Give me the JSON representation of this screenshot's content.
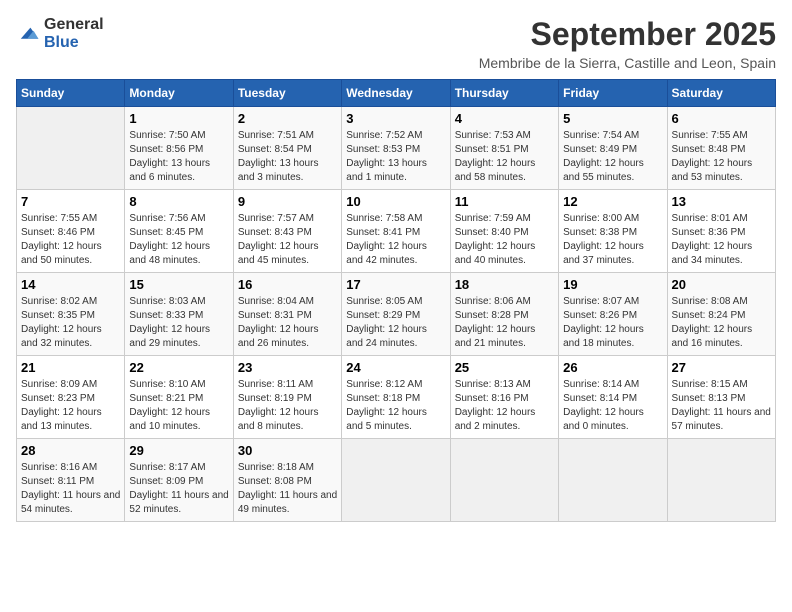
{
  "header": {
    "logo_line1": "General",
    "logo_line2": "Blue",
    "month_title": "September 2025",
    "subtitle": "Membribe de la Sierra, Castille and Leon, Spain"
  },
  "weekdays": [
    "Sunday",
    "Monday",
    "Tuesday",
    "Wednesday",
    "Thursday",
    "Friday",
    "Saturday"
  ],
  "weeks": [
    [
      {
        "day": "",
        "sunrise": "",
        "sunset": "",
        "daylight": ""
      },
      {
        "day": "1",
        "sunrise": "Sunrise: 7:50 AM",
        "sunset": "Sunset: 8:56 PM",
        "daylight": "Daylight: 13 hours and 6 minutes."
      },
      {
        "day": "2",
        "sunrise": "Sunrise: 7:51 AM",
        "sunset": "Sunset: 8:54 PM",
        "daylight": "Daylight: 13 hours and 3 minutes."
      },
      {
        "day": "3",
        "sunrise": "Sunrise: 7:52 AM",
        "sunset": "Sunset: 8:53 PM",
        "daylight": "Daylight: 13 hours and 1 minute."
      },
      {
        "day": "4",
        "sunrise": "Sunrise: 7:53 AM",
        "sunset": "Sunset: 8:51 PM",
        "daylight": "Daylight: 12 hours and 58 minutes."
      },
      {
        "day": "5",
        "sunrise": "Sunrise: 7:54 AM",
        "sunset": "Sunset: 8:49 PM",
        "daylight": "Daylight: 12 hours and 55 minutes."
      },
      {
        "day": "6",
        "sunrise": "Sunrise: 7:55 AM",
        "sunset": "Sunset: 8:48 PM",
        "daylight": "Daylight: 12 hours and 53 minutes."
      }
    ],
    [
      {
        "day": "7",
        "sunrise": "Sunrise: 7:55 AM",
        "sunset": "Sunset: 8:46 PM",
        "daylight": "Daylight: 12 hours and 50 minutes."
      },
      {
        "day": "8",
        "sunrise": "Sunrise: 7:56 AM",
        "sunset": "Sunset: 8:45 PM",
        "daylight": "Daylight: 12 hours and 48 minutes."
      },
      {
        "day": "9",
        "sunrise": "Sunrise: 7:57 AM",
        "sunset": "Sunset: 8:43 PM",
        "daylight": "Daylight: 12 hours and 45 minutes."
      },
      {
        "day": "10",
        "sunrise": "Sunrise: 7:58 AM",
        "sunset": "Sunset: 8:41 PM",
        "daylight": "Daylight: 12 hours and 42 minutes."
      },
      {
        "day": "11",
        "sunrise": "Sunrise: 7:59 AM",
        "sunset": "Sunset: 8:40 PM",
        "daylight": "Daylight: 12 hours and 40 minutes."
      },
      {
        "day": "12",
        "sunrise": "Sunrise: 8:00 AM",
        "sunset": "Sunset: 8:38 PM",
        "daylight": "Daylight: 12 hours and 37 minutes."
      },
      {
        "day": "13",
        "sunrise": "Sunrise: 8:01 AM",
        "sunset": "Sunset: 8:36 PM",
        "daylight": "Daylight: 12 hours and 34 minutes."
      }
    ],
    [
      {
        "day": "14",
        "sunrise": "Sunrise: 8:02 AM",
        "sunset": "Sunset: 8:35 PM",
        "daylight": "Daylight: 12 hours and 32 minutes."
      },
      {
        "day": "15",
        "sunrise": "Sunrise: 8:03 AM",
        "sunset": "Sunset: 8:33 PM",
        "daylight": "Daylight: 12 hours and 29 minutes."
      },
      {
        "day": "16",
        "sunrise": "Sunrise: 8:04 AM",
        "sunset": "Sunset: 8:31 PM",
        "daylight": "Daylight: 12 hours and 26 minutes."
      },
      {
        "day": "17",
        "sunrise": "Sunrise: 8:05 AM",
        "sunset": "Sunset: 8:29 PM",
        "daylight": "Daylight: 12 hours and 24 minutes."
      },
      {
        "day": "18",
        "sunrise": "Sunrise: 8:06 AM",
        "sunset": "Sunset: 8:28 PM",
        "daylight": "Daylight: 12 hours and 21 minutes."
      },
      {
        "day": "19",
        "sunrise": "Sunrise: 8:07 AM",
        "sunset": "Sunset: 8:26 PM",
        "daylight": "Daylight: 12 hours and 18 minutes."
      },
      {
        "day": "20",
        "sunrise": "Sunrise: 8:08 AM",
        "sunset": "Sunset: 8:24 PM",
        "daylight": "Daylight: 12 hours and 16 minutes."
      }
    ],
    [
      {
        "day": "21",
        "sunrise": "Sunrise: 8:09 AM",
        "sunset": "Sunset: 8:23 PM",
        "daylight": "Daylight: 12 hours and 13 minutes."
      },
      {
        "day": "22",
        "sunrise": "Sunrise: 8:10 AM",
        "sunset": "Sunset: 8:21 PM",
        "daylight": "Daylight: 12 hours and 10 minutes."
      },
      {
        "day": "23",
        "sunrise": "Sunrise: 8:11 AM",
        "sunset": "Sunset: 8:19 PM",
        "daylight": "Daylight: 12 hours and 8 minutes."
      },
      {
        "day": "24",
        "sunrise": "Sunrise: 8:12 AM",
        "sunset": "Sunset: 8:18 PM",
        "daylight": "Daylight: 12 hours and 5 minutes."
      },
      {
        "day": "25",
        "sunrise": "Sunrise: 8:13 AM",
        "sunset": "Sunset: 8:16 PM",
        "daylight": "Daylight: 12 hours and 2 minutes."
      },
      {
        "day": "26",
        "sunrise": "Sunrise: 8:14 AM",
        "sunset": "Sunset: 8:14 PM",
        "daylight": "Daylight: 12 hours and 0 minutes."
      },
      {
        "day": "27",
        "sunrise": "Sunrise: 8:15 AM",
        "sunset": "Sunset: 8:13 PM",
        "daylight": "Daylight: 11 hours and 57 minutes."
      }
    ],
    [
      {
        "day": "28",
        "sunrise": "Sunrise: 8:16 AM",
        "sunset": "Sunset: 8:11 PM",
        "daylight": "Daylight: 11 hours and 54 minutes."
      },
      {
        "day": "29",
        "sunrise": "Sunrise: 8:17 AM",
        "sunset": "Sunset: 8:09 PM",
        "daylight": "Daylight: 11 hours and 52 minutes."
      },
      {
        "day": "30",
        "sunrise": "Sunrise: 8:18 AM",
        "sunset": "Sunset: 8:08 PM",
        "daylight": "Daylight: 11 hours and 49 minutes."
      },
      {
        "day": "",
        "sunrise": "",
        "sunset": "",
        "daylight": ""
      },
      {
        "day": "",
        "sunrise": "",
        "sunset": "",
        "daylight": ""
      },
      {
        "day": "",
        "sunrise": "",
        "sunset": "",
        "daylight": ""
      },
      {
        "day": "",
        "sunrise": "",
        "sunset": "",
        "daylight": ""
      }
    ]
  ]
}
